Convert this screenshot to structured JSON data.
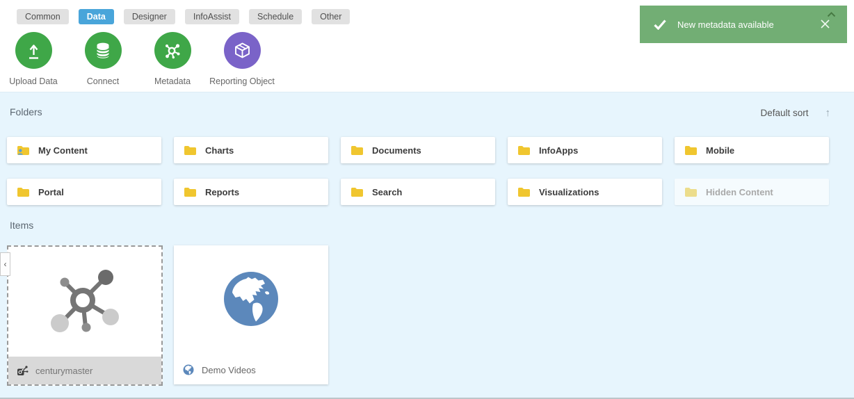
{
  "tabs": [
    {
      "label": "Common"
    },
    {
      "label": "Data"
    },
    {
      "label": "Designer"
    },
    {
      "label": "InfoAssist"
    },
    {
      "label": "Schedule"
    },
    {
      "label": "Other"
    }
  ],
  "active_tab": "Data",
  "actions": [
    {
      "label": "Upload Data",
      "icon": "upload-icon"
    },
    {
      "label": "Connect",
      "icon": "database-icon"
    },
    {
      "label": "Metadata",
      "icon": "molecule-icon"
    },
    {
      "label": "Reporting Object",
      "icon": "cube-icon"
    }
  ],
  "toast": {
    "message": "New metadata available",
    "check_icon": "checkmark-icon",
    "close_icon": "close-x-icon",
    "caret_icon": "chevron-up-icon"
  },
  "folders": {
    "section_label": "Folders",
    "sort_label": "Default sort",
    "sort_arrow": "↑",
    "items": [
      {
        "label": "My Content",
        "icon": "folder-user-icon"
      },
      {
        "label": "Charts",
        "icon": "folder-icon"
      },
      {
        "label": "Documents",
        "icon": "folder-icon"
      },
      {
        "label": "InfoApps",
        "icon": "folder-icon"
      },
      {
        "label": "Mobile",
        "icon": "folder-icon"
      },
      {
        "label": "Portal",
        "icon": "folder-icon"
      },
      {
        "label": "Reports",
        "icon": "folder-icon"
      },
      {
        "label": "Search",
        "icon": "folder-icon"
      },
      {
        "label": "Visualizations",
        "icon": "folder-icon"
      },
      {
        "label": "Hidden Content",
        "icon": "folder-icon",
        "state": "disabled"
      }
    ]
  },
  "items": {
    "section_label": "Items",
    "cards": [
      {
        "label": "centurymaster",
        "icon": "master-file-molecule-icon",
        "selected": true
      },
      {
        "label": "Demo Videos",
        "icon": "globe-icon",
        "selected": false
      }
    ]
  },
  "collapse_chevron": "‹",
  "colors": {
    "accent_blue": "#49a5da",
    "action_green": "#3fa748",
    "action_purple": "#7a63c8",
    "toast_green": "#72ae74",
    "folder_yellow": "#f0c62f",
    "content_bg": "#e7f5fd"
  }
}
